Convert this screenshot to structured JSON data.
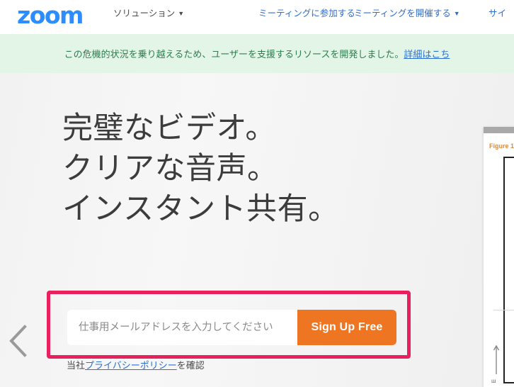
{
  "nav": {
    "logo_text": "zoom",
    "items": [
      {
        "label": "ソリューション",
        "caret": "▼",
        "name": "solutions"
      },
      {
        "label": "ミーティングに参加する",
        "caret": "",
        "name": "join-meeting"
      },
      {
        "label": "ミーティングを開催する",
        "caret": "▼",
        "name": "host-meeting"
      },
      {
        "label": "サイ",
        "caret": "",
        "name": "sign-in"
      }
    ]
  },
  "banner": {
    "text": "この危機的状況を乗り越えるため、ユーザーを支援するリソースを開発しました。",
    "link_text": "詳細はこち",
    "background_color": "#E3F5E7",
    "text_color": "#2F7D4F",
    "link_color": "#2D6FD0"
  },
  "hero": {
    "heading": "完璧なビデオ。\nクリアな音声。\nインスタント共有。",
    "prev_arrow_icon": "chevron-left-icon"
  },
  "signup": {
    "email_placeholder": "仕事用メールアドレスを入力してください",
    "email_value": "",
    "button_label": "Sign Up Free",
    "button_color": "#EE7623",
    "highlight_color": "#E8215E",
    "privacy_prefix": "当社",
    "privacy_link": "プライバシーポリシー",
    "privacy_suffix": "を確認"
  },
  "figure_panel": {
    "label": "Figure 1",
    "label_color": "#E08A3C",
    "arrow_icon": "arrow-up-icon",
    "glyph": "ш"
  }
}
